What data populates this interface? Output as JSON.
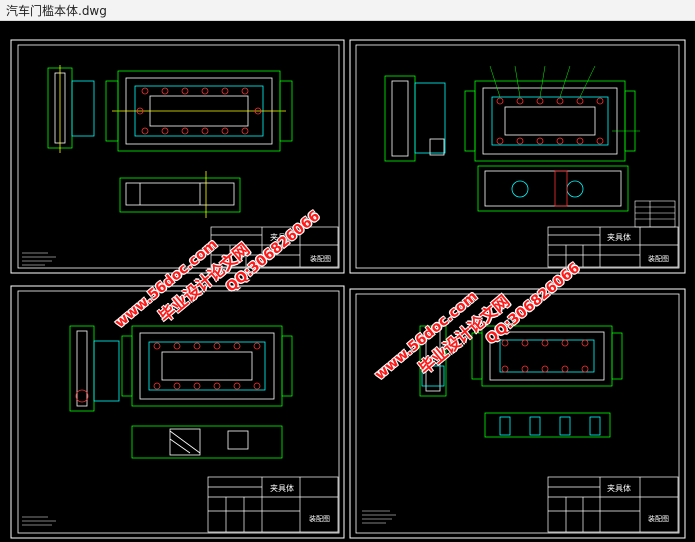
{
  "window": {
    "title": "汽车门槛本体.dwg"
  },
  "sheets": [
    {
      "id": "sheet-1",
      "title_block": {
        "name": "夹具体",
        "label": "装配图"
      }
    },
    {
      "id": "sheet-2",
      "title_block": {
        "name": "夹具体",
        "label": "装配图"
      }
    },
    {
      "id": "sheet-3",
      "title_block": {
        "name": "夹具体",
        "label": "装配图"
      }
    },
    {
      "id": "sheet-4",
      "title_block": {
        "name": "夹具体",
        "label": "装配图"
      }
    }
  ],
  "watermarks": [
    {
      "url": "www.56doc.com",
      "brand": "毕业设计论文网",
      "qq": "QQ:306826066"
    },
    {
      "url": "www.56doc.com",
      "brand": "毕业设计论文网",
      "qq": "QQ:306826066"
    }
  ],
  "colors": {
    "drawing_bg": "#000000",
    "lines": "#ffffff",
    "green": "#00ff00",
    "cyan": "#00ffff",
    "red": "#ff3030",
    "magenta": "#ff00ff",
    "watermark": "#ff1a1a"
  }
}
